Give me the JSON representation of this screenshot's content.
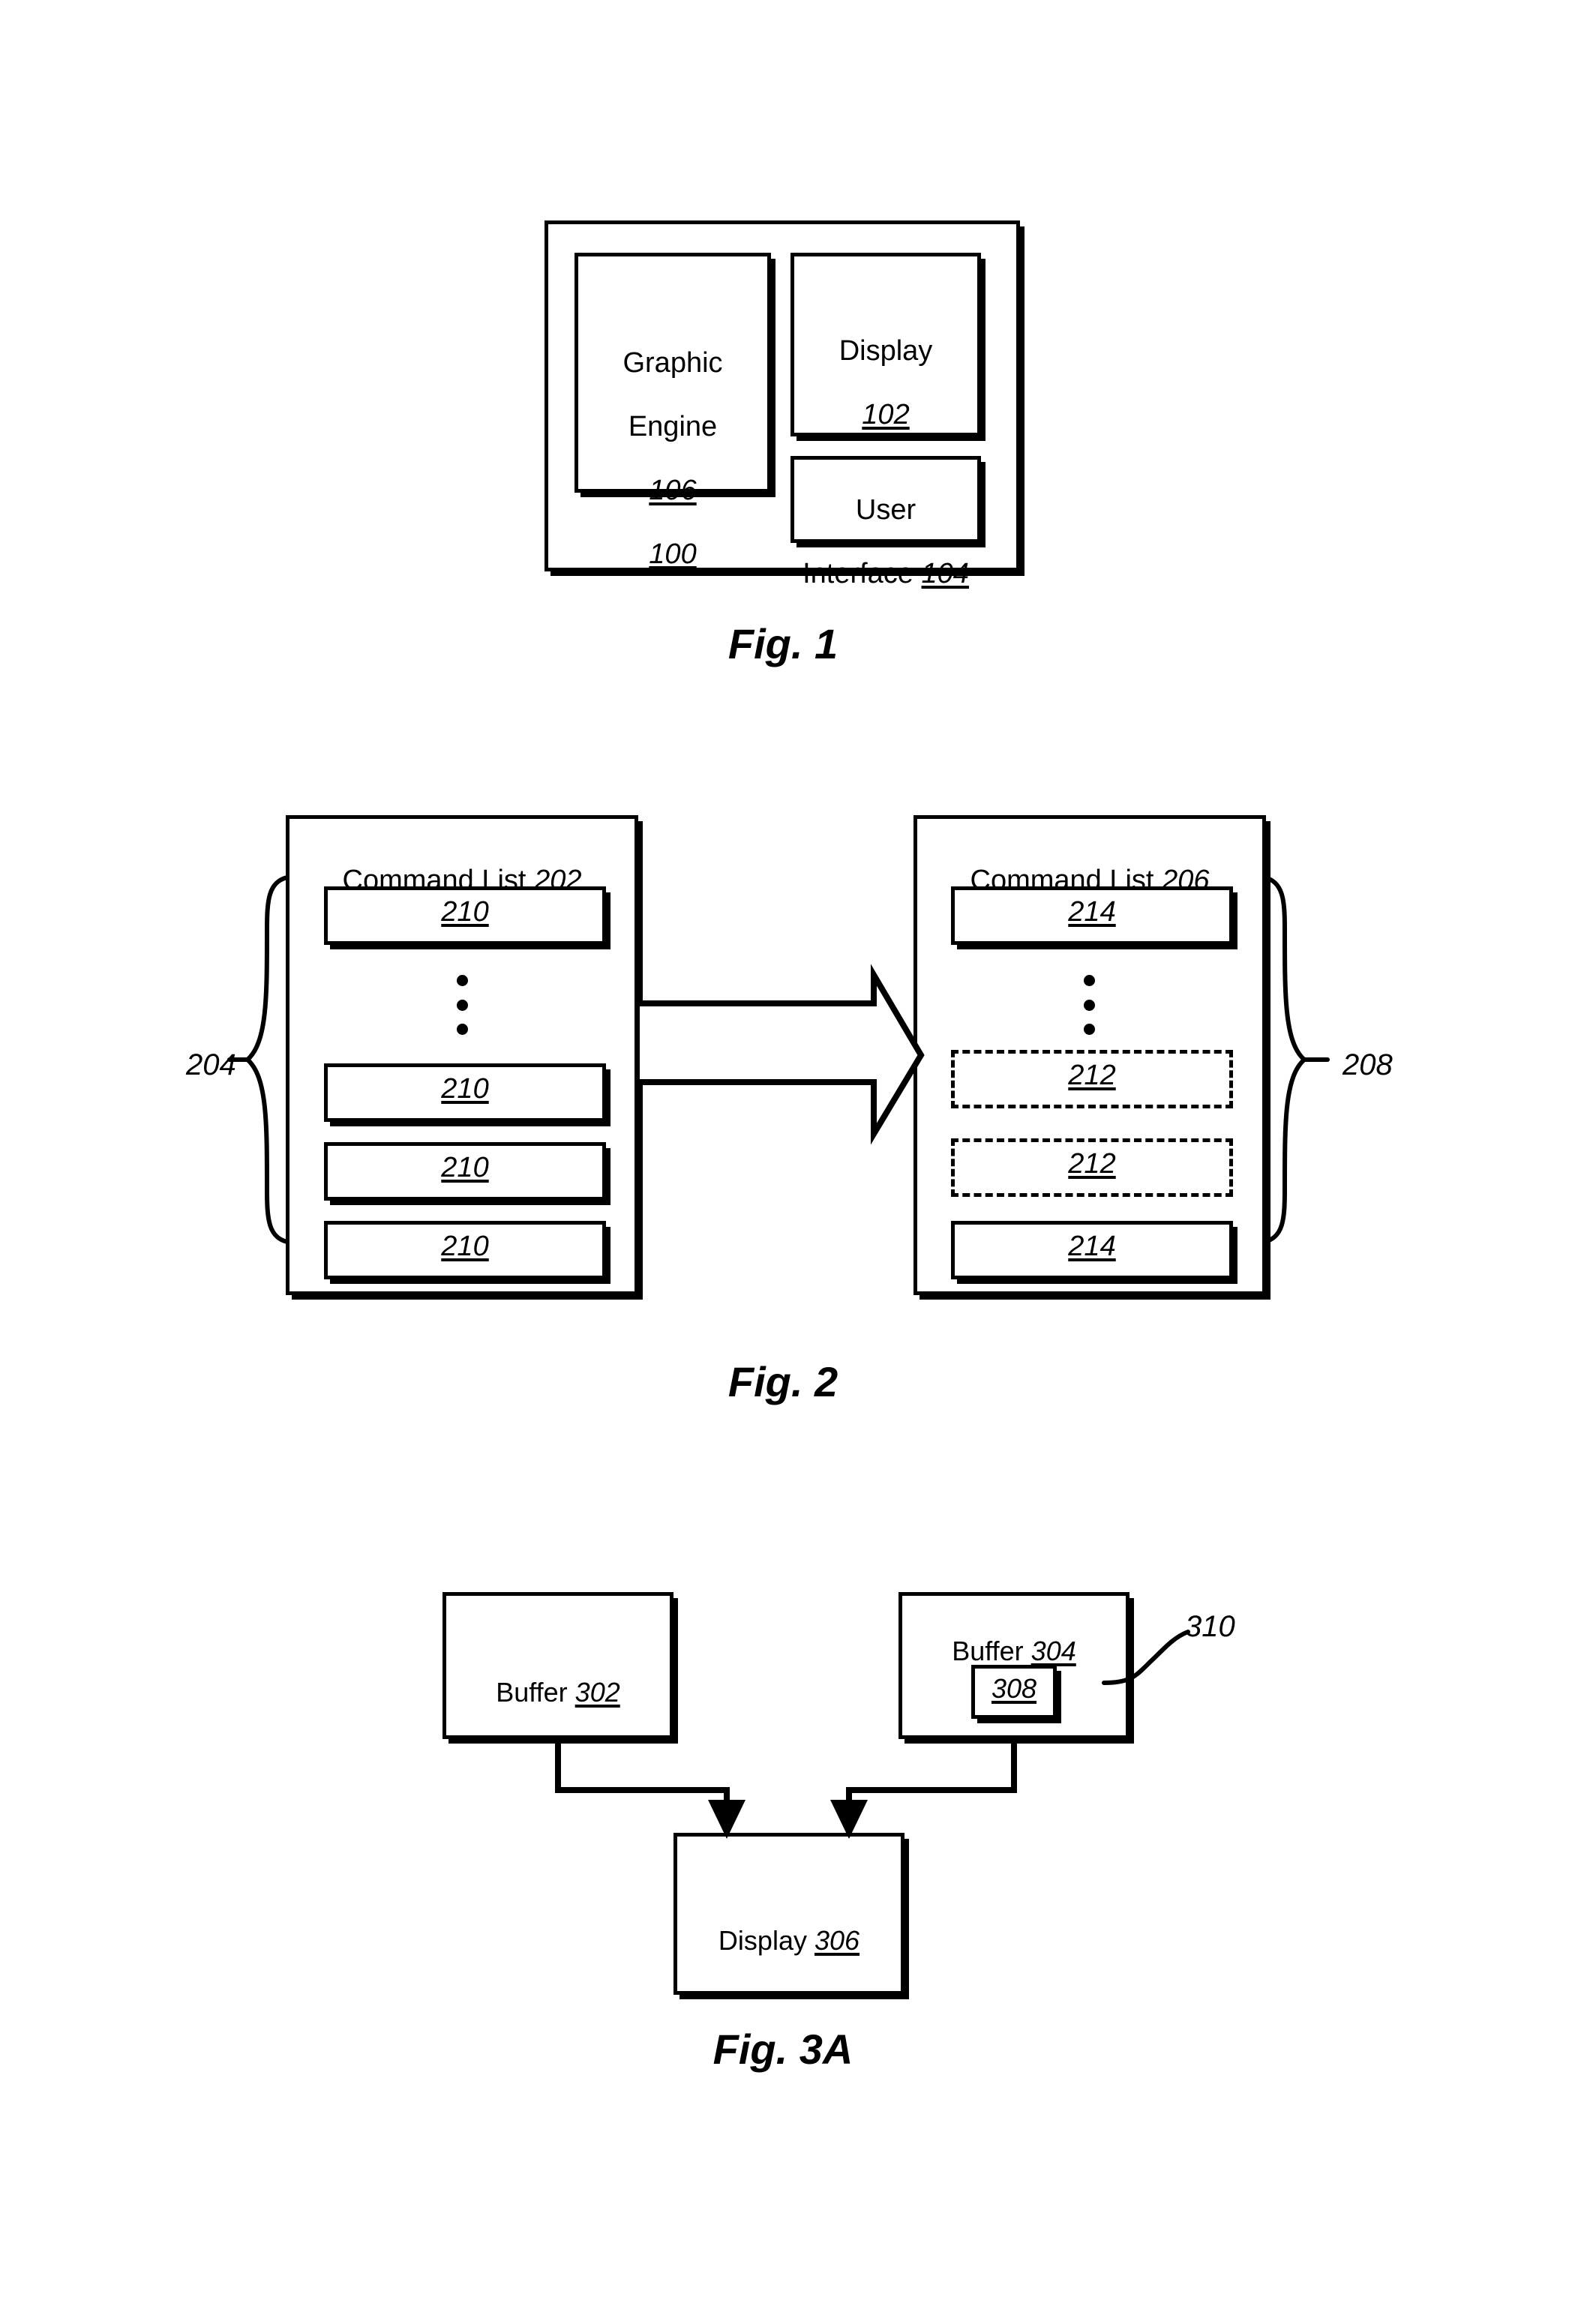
{
  "document": {
    "type": "patent-drawing-sheet",
    "background_color": "#ffffff",
    "ink_color": "#000000"
  },
  "figure1": {
    "caption": "Fig. 1",
    "outer_ref": "100",
    "blocks": [
      {
        "name": "graphic-engine",
        "line1": "Graphic",
        "line2": "Engine",
        "ref": "106"
      },
      {
        "name": "display",
        "line1": "Display",
        "ref": "102"
      },
      {
        "name": "user-interface",
        "line1": "User",
        "line2": "Interface",
        "ref": "104"
      }
    ]
  },
  "figure2": {
    "caption": "Fig. 2",
    "left_list": {
      "title_text": "Command List",
      "title_ref": "202",
      "brace_ref": "204",
      "items": [
        {
          "ref": "210",
          "style": "solid"
        },
        {
          "ref": "210",
          "style": "solid"
        },
        {
          "ref": "210",
          "style": "solid"
        },
        {
          "ref": "210",
          "style": "solid"
        }
      ],
      "ellipsis": "vertical-three-dots"
    },
    "right_list": {
      "title_text": "Command List",
      "title_ref": "206",
      "brace_ref": "208",
      "items": [
        {
          "ref": "214",
          "style": "solid"
        },
        {
          "ref": "212",
          "style": "dashed"
        },
        {
          "ref": "212",
          "style": "dashed"
        },
        {
          "ref": "214",
          "style": "solid"
        }
      ],
      "ellipsis": "vertical-three-dots"
    },
    "transform_arrow": "block-arrow-right"
  },
  "figure3a": {
    "caption": "Fig. 3A",
    "blocks": [
      {
        "name": "buffer-302",
        "label": "Buffer",
        "ref": "302"
      },
      {
        "name": "buffer-304",
        "label": "Buffer",
        "ref": "304"
      },
      {
        "name": "inner-region-308",
        "label": "",
        "ref": "308"
      },
      {
        "name": "display-306",
        "label": "Display",
        "ref": "306"
      }
    ],
    "leader_ref": "310",
    "connectors": [
      {
        "from": "buffer-302",
        "to": "display-306",
        "arrow": "down"
      },
      {
        "from": "buffer-304",
        "to": "display-306",
        "arrow": "down"
      }
    ]
  }
}
